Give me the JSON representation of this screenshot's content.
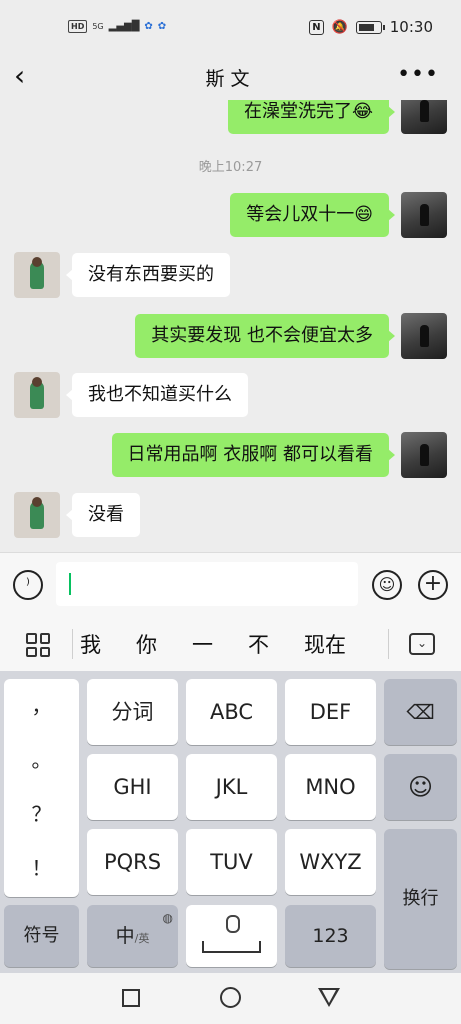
{
  "status_bar": {
    "left_badge": "HD",
    "network": "5G",
    "time": "10:30",
    "nfc": "N",
    "battery_level": 0.85
  },
  "header": {
    "title": "斯文",
    "back_icon": "chevron-left-icon",
    "more_icon": "more-dots-icon"
  },
  "messages": [
    {
      "side": "me",
      "text": "在澡堂洗完了😂"
    },
    {
      "type": "time",
      "text": "晚上10:27"
    },
    {
      "side": "me",
      "text": "等会儿双十一😄"
    },
    {
      "side": "other",
      "text": "没有东西要买的"
    },
    {
      "side": "me",
      "text": "其实要发现 也不会便宜太多"
    },
    {
      "side": "other",
      "text": "我也不知道买什么"
    },
    {
      "side": "me",
      "text": "日常用品啊 衣服啊 都可以看看"
    },
    {
      "side": "other",
      "text": "没看"
    }
  ],
  "input_bar": {
    "voice_icon": "voice-icon",
    "text_value": "",
    "emoji_icon": "emoji-icon",
    "plus_icon": "plus-icon"
  },
  "candidates": {
    "grid_icon": "grid-icon",
    "words": [
      "我",
      "你",
      "一",
      "不",
      "现在"
    ],
    "collapse_icon": "keyboard-collapse-icon"
  },
  "keyboard": {
    "punctuation": [
      "，",
      "。",
      "？",
      "！"
    ],
    "keys_row1": [
      "分词",
      "ABC",
      "DEF"
    ],
    "keys_row2": [
      "GHI",
      "JKL",
      "MNO"
    ],
    "keys_row3": [
      "PQRS",
      "TUV",
      "WXYZ"
    ],
    "delete_icon": "backspace-icon",
    "emoji_icon": "emoji-icon",
    "enter_label": "换行",
    "symbol_label": "符号",
    "lang_main": "中",
    "lang_sub": "/英",
    "space_icon": "space-mic-icon",
    "numbers_label": "123"
  },
  "system_nav": {
    "recents_icon": "square-icon",
    "home_icon": "circle-icon",
    "back_icon": "triangle-back-icon"
  }
}
